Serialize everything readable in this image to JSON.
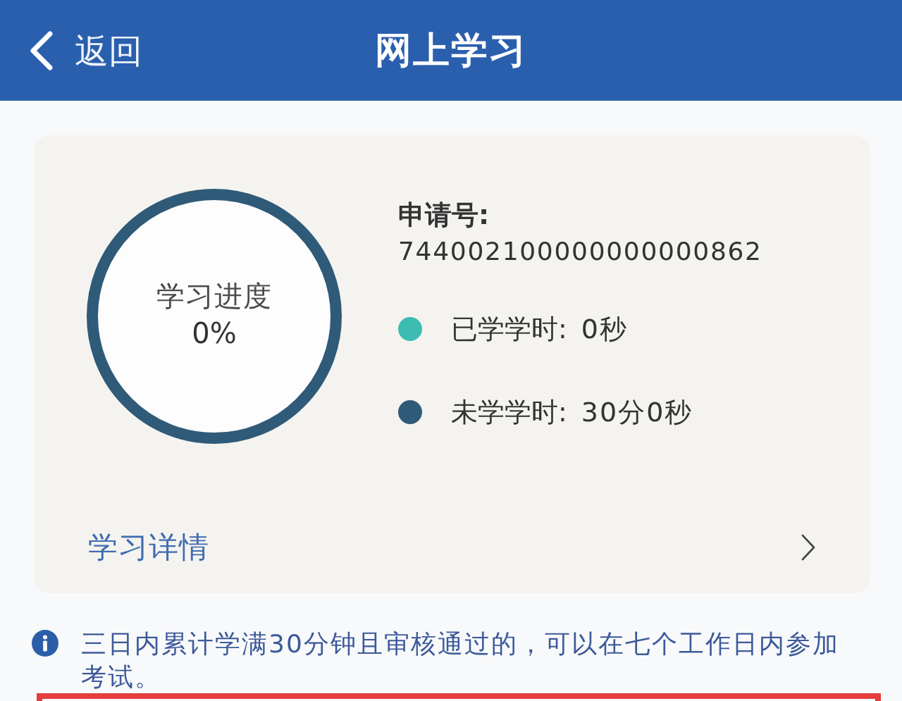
{
  "header": {
    "back_label": "返回",
    "title": "网上学习"
  },
  "progress": {
    "title": "学习进度",
    "percent": "0%"
  },
  "application": {
    "label": "申请号:",
    "number": "744002100000000000862"
  },
  "legend": [
    {
      "label": "已学学时:",
      "value": "0秒",
      "color": "#3dbcb2"
    },
    {
      "label": "未学学时:",
      "value": "30分0秒",
      "color": "#2f5a78"
    }
  ],
  "details_link": {
    "label": "学习详情"
  },
  "notice": {
    "text": "三日内累计学满30分钟且审核通过的，可以在七个工作日内参加考试。"
  }
}
